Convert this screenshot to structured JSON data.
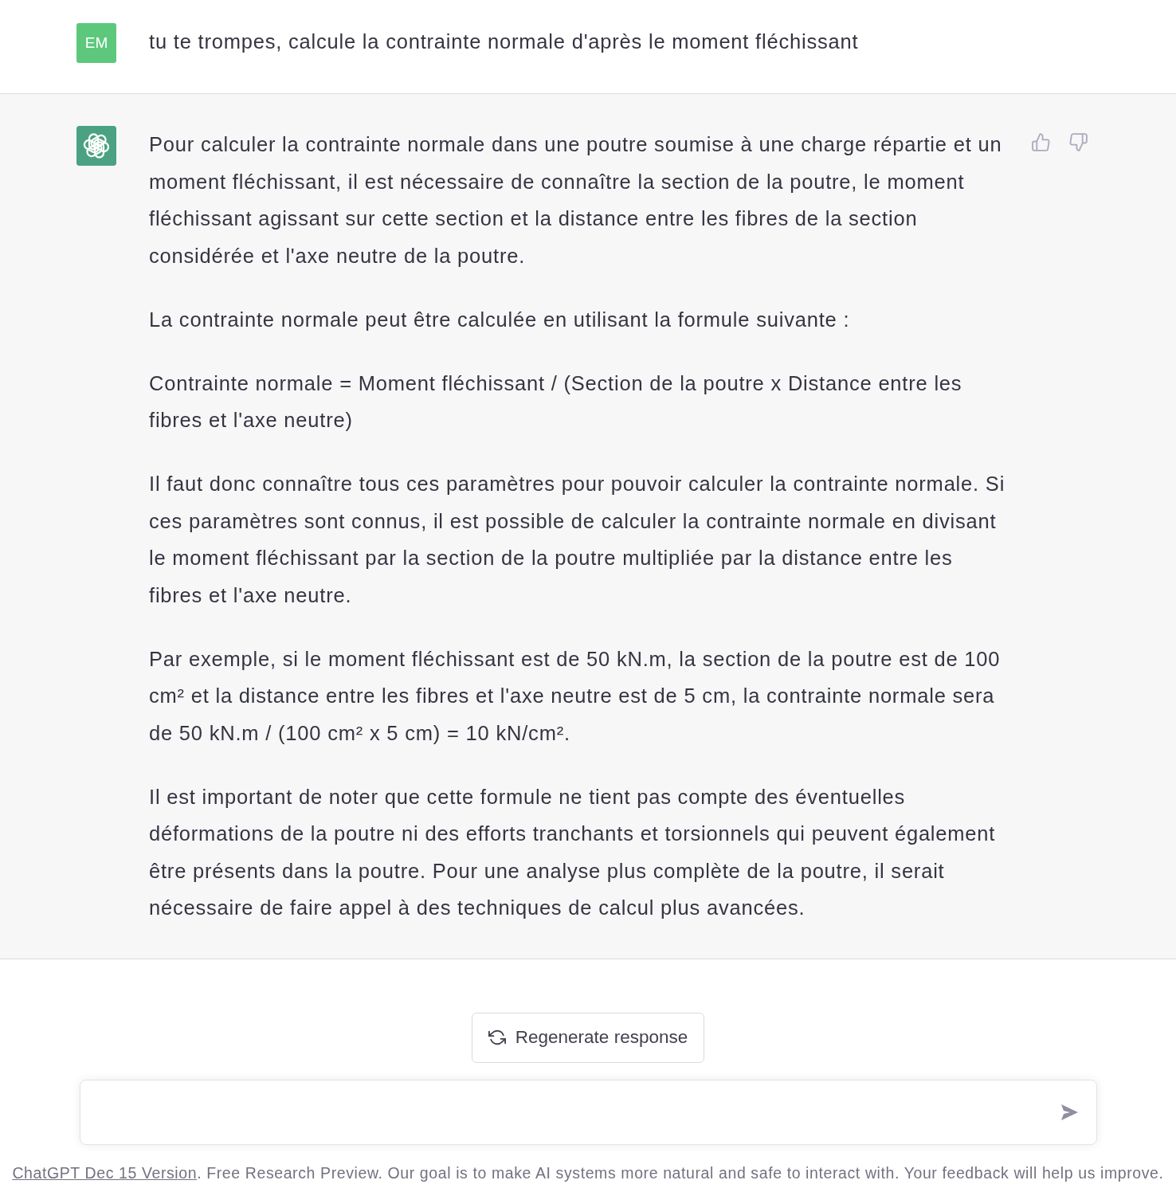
{
  "messages": [
    {
      "kind": "user",
      "avatar": "EM",
      "paragraphs": [
        "tu te trompes, calcule la contrainte normale d'après le moment fléchissant"
      ]
    },
    {
      "kind": "assistant",
      "paragraphs": [
        "Pour calculer la contrainte normale dans une poutre soumise à une charge répartie et un moment fléchissant, il est nécessaire de connaître la section de la poutre, le moment fléchissant agissant sur cette section et la distance entre les fibres de la section considérée et l'axe neutre de la poutre.",
        "La contrainte normale peut être calculée en utilisant la formule suivante :",
        "Contrainte normale = Moment fléchissant / (Section de la poutre x Distance entre les fibres et l'axe neutre)",
        "Il faut donc connaître tous ces paramètres pour pouvoir calculer la contrainte normale. Si ces paramètres sont connus, il est possible de calculer la contrainte normale en divisant le moment fléchissant par la section de la poutre multipliée par la distance entre les fibres et l'axe neutre.",
        "Par exemple, si le moment fléchissant est de 50 kN.m, la section de la poutre est de 100 cm² et la distance entre les fibres et l'axe neutre est de 5 cm, la contrainte normale sera de 50 kN.m / (100 cm² x 5 cm) = 10 kN/cm².",
        "Il est important de noter que cette formule ne tient pas compte des éventuelles déformations de la poutre ni des efforts tranchants et torsionnels qui peuvent également être présents dans la poutre. Pour une analyse plus complète de la poutre, il serait nécessaire de faire appel à des techniques de calcul plus avancées."
      ]
    }
  ],
  "regenerate_button": {
    "label": "Regenerate response"
  },
  "footer": {
    "link": "ChatGPT Dec 15 Version",
    "text": ". Free Research Preview. Our goal is to make AI systems more natural and safe to interact with. Your feedback will help us improve."
  }
}
